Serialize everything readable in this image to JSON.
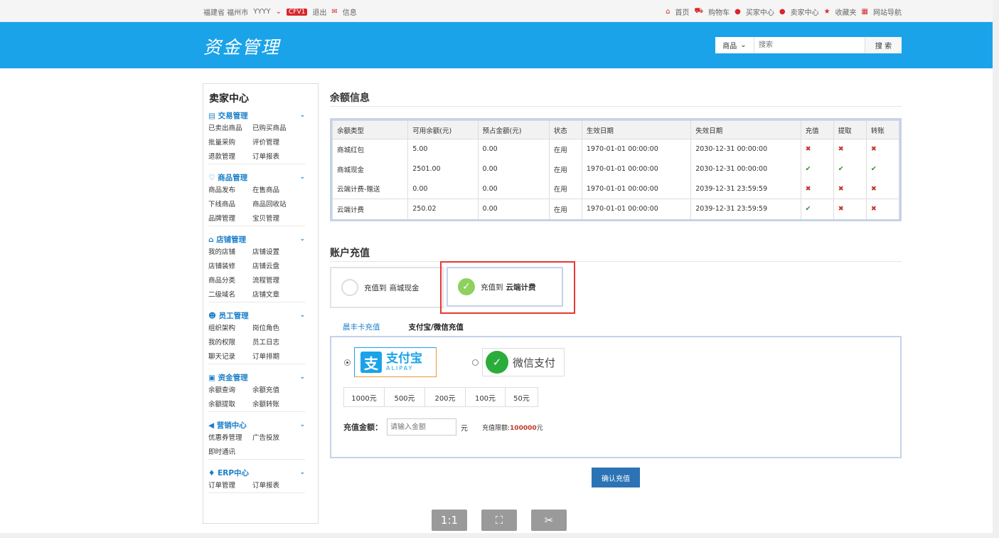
{
  "topbar": {
    "location": "福建省 福州市",
    "user": "YYYY",
    "level": "CFV1",
    "logout": "退出",
    "messages": "信息",
    "home": "首页",
    "cart": "购物车",
    "buyer_center": "买家中心",
    "seller_center": "卖家中心",
    "favorites": "收藏夹",
    "site_nav": "网站导航"
  },
  "header": {
    "logo": "资金管理",
    "search_category": "商品",
    "search_placeholder": "搜索",
    "search_button": "搜 索"
  },
  "sidebar": {
    "title": "卖家中心",
    "groups": [
      {
        "title": "交易管理",
        "icon": "list-icon",
        "items": [
          "已卖出商品",
          "已购买商品",
          "批量采购",
          "评价管理",
          "退款管理",
          "订单报表"
        ]
      },
      {
        "title": "商品管理",
        "icon": "heart-icon",
        "items": [
          "商品发布",
          "在售商品",
          "下线商品",
          "商品回收站",
          "品牌管理",
          "宝贝管理"
        ]
      },
      {
        "title": "店铺管理",
        "icon": "home-icon",
        "items": [
          "我的店铺",
          "店铺设置",
          "店铺装修",
          "店铺云盘",
          "商品分类",
          "流程管理",
          "二级域名",
          "店铺文章"
        ]
      },
      {
        "title": "员工管理",
        "icon": "users-icon",
        "items": [
          "组织架构",
          "岗位角色",
          "我的权限",
          "员工日志",
          "聊天记录",
          "订单排期"
        ]
      },
      {
        "title": "资金管理",
        "icon": "money-icon",
        "items": [
          "余额查询",
          "余额充值",
          "余额提取",
          "余额转账"
        ]
      },
      {
        "title": "营销中心",
        "icon": "speaker-icon",
        "items": [
          "优惠券管理",
          "广告投放",
          "即时通讯"
        ]
      },
      {
        "title": "ERP中心",
        "icon": "flame-icon",
        "items": [
          "订单管理",
          "订单报表"
        ]
      }
    ]
  },
  "balance": {
    "title": "余额信息",
    "headers": [
      "余额类型",
      "可用余额(元)",
      "预占金额(元)",
      "状态",
      "生效日期",
      "失效日期",
      "充值",
      "提取",
      "转账"
    ],
    "rows": [
      {
        "type": "商城红包",
        "available": "5.00",
        "reserved": "0.00",
        "status": "在用",
        "start": "1970-01-01 00:00:00",
        "end": "2030-12-31 00:00:00",
        "recharge": "✖",
        "withdraw": "✖",
        "transfer": "✖"
      },
      {
        "type": "商城现金",
        "available": "2501.00",
        "reserved": "0.00",
        "status": "在用",
        "start": "1970-01-01 00:00:00",
        "end": "2030-12-31 00:00:00",
        "recharge": "✔",
        "withdraw": "✔",
        "transfer": "✔"
      },
      {
        "type": "云端计费-赠送",
        "available": "0.00",
        "reserved": "0.00",
        "status": "在用",
        "start": "1970-01-01 00:00:00",
        "end": "2039-12-31 23:59:59",
        "recharge": "✖",
        "withdraw": "✖",
        "transfer": "✖"
      },
      {
        "type": "云端计费",
        "available": "250.02",
        "reserved": "0.00",
        "status": "在用",
        "start": "1970-01-01 00:00:00",
        "end": "2039-12-31 23:59:59",
        "recharge": "✔",
        "withdraw": "✖",
        "transfer": "✖"
      }
    ]
  },
  "recharge": {
    "title": "账户充值",
    "option1_prefix": "充值到",
    "option1_target": "商城现金",
    "option2_prefix": "充值到",
    "option2_target": "云端计费",
    "tab_card": "晨丰卡充值",
    "tab_online": "支付宝/微信充值",
    "alipay_cn": "支付宝",
    "alipay_en": "ALIPAY",
    "wechat": "微信支付",
    "amounts": [
      "1000元",
      "500元",
      "200元",
      "100元",
      "50元"
    ],
    "amount_label": "充值金额：",
    "amount_placeholder": "请输入金额",
    "unit": "元",
    "limit_label": "充值限额:",
    "limit_value": "100000",
    "limit_unit": "元",
    "confirm": "确认充值"
  },
  "viewer": {
    "actual_size": "1:1",
    "fit": "⛶",
    "crop": "✂"
  }
}
